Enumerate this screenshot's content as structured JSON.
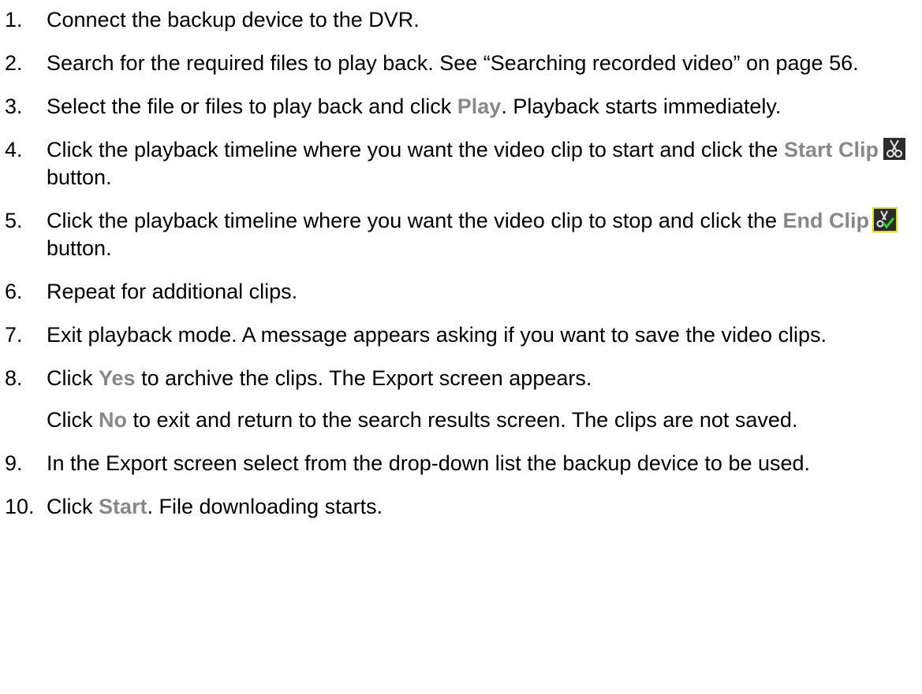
{
  "steps": [
    {
      "num": "1.",
      "parts": [
        {
          "t": "Connect the backup device to the DVR."
        }
      ]
    },
    {
      "num": "2.",
      "parts": [
        {
          "t": "Search for the required files to play back. See “Searching recorded video” on page 56."
        }
      ]
    },
    {
      "num": "3.",
      "parts": [
        {
          "t": "Select the file or files to play back and click "
        },
        {
          "ui": "Play"
        },
        {
          "t": ". Playback starts immediately."
        }
      ]
    },
    {
      "num": "4.",
      "parts": [
        {
          "t": "Click the playback timeline where you want the video clip to start and click the "
        },
        {
          "ui": "Start Clip"
        },
        {
          "icon": "scissors-start-clip-icon"
        },
        {
          "t": " button."
        }
      ]
    },
    {
      "num": "5.",
      "parts": [
        {
          "t": "Click the playback timeline where you want the video clip to stop and click the "
        },
        {
          "ui": "End Clip"
        },
        {
          "icon": "scissors-end-clip-icon"
        },
        {
          "t": " button."
        }
      ]
    },
    {
      "num": "6.",
      "parts": [
        {
          "t": "Repeat for additional clips."
        }
      ]
    },
    {
      "num": "7.",
      "parts": [
        {
          "t": "Exit playback mode. A message appears asking if you want to save the video clips."
        }
      ]
    },
    {
      "num": "8.",
      "parts": [
        {
          "t": "Click "
        },
        {
          "ui": "Yes"
        },
        {
          "t": " to archive the clips. The Export screen appears."
        }
      ],
      "extra": [
        {
          "t": "Click "
        },
        {
          "ui": "No"
        },
        {
          "t": " to exit and return to the search results screen. The clips are not saved."
        }
      ]
    },
    {
      "num": "9.",
      "parts": [
        {
          "t": "In the Export screen select from the drop-down list the backup device to be used."
        }
      ]
    },
    {
      "num": "10.",
      "parts": [
        {
          "t": "Click "
        },
        {
          "ui": "Start"
        },
        {
          "t": ". File downloading starts."
        }
      ]
    }
  ],
  "colors": {
    "ui_label": "#888888",
    "icon_bg": "#2b2b2b",
    "end_clip_highlight": "#e4e400",
    "end_clip_check": "#2fd12f"
  }
}
